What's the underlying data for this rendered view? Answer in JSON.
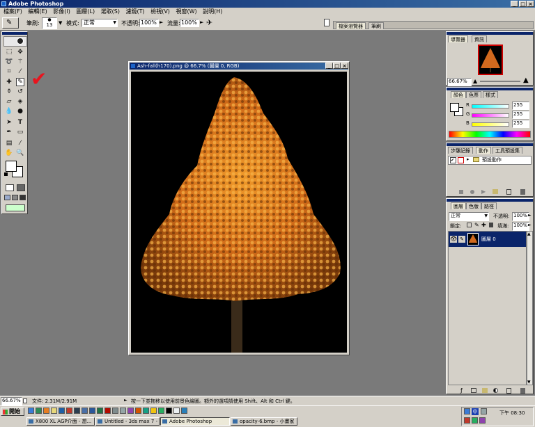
{
  "app": {
    "title": "Adobe Photoshop"
  },
  "menu": [
    "檔案(F)",
    "編輯(E)",
    "影像(I)",
    "圖層(L)",
    "選取(S)",
    "濾鏡(T)",
    "檢視(V)",
    "視窗(W)",
    "說明(H)"
  ],
  "options": {
    "brush_label": "筆刷:",
    "brush_size": "13",
    "mode_label": "模式:",
    "mode_value": "正常",
    "opacity_label": "不透明:",
    "opacity_value": "100%",
    "flow_label": "流量:",
    "flow_value": "100%",
    "well_tabs": [
      "檔案瀏覽器",
      "筆刷"
    ]
  },
  "annotation": {
    "mark": "✔",
    "color": "#e8141e"
  },
  "document": {
    "title": "Ash-fall(h170).png @ 66.7% (圖層 0, RGB)",
    "background": "#000000",
    "foliage_color": "#d2691e"
  },
  "navigator": {
    "tabs": [
      "導覽器",
      "資訊"
    ],
    "zoom": "66.67%"
  },
  "color_panel": {
    "tabs": [
      "顏色",
      "色票",
      "樣式"
    ],
    "channels": [
      {
        "label": "R",
        "value": "255",
        "gradient": "#00ffff"
      },
      {
        "label": "G",
        "value": "255",
        "gradient": "#ff00ff"
      },
      {
        "label": "B",
        "value": "255",
        "gradient": "#ffff00"
      }
    ]
  },
  "history_panel": {
    "tabs": [
      "步驟記錄",
      "動作",
      "工具預設集"
    ],
    "item": "預設動作"
  },
  "layers_panel": {
    "tabs": [
      "圖層",
      "色版",
      "路徑"
    ],
    "mode": "正常",
    "opacity_label": "不透明:",
    "opacity_value": "100%",
    "lock_label": "鎖定:",
    "fill_label": "填滿:",
    "fill_value": "100%",
    "layer_name": "圖層 0"
  },
  "status": {
    "zoom": "66.67%",
    "doc_info": "文件: 2.31M/2.91M",
    "hint": "按一下並拖移以使用前景色繪圖。額外的選項請使用 Shift、Alt 和 Ctrl 鍵。"
  },
  "taskbar": {
    "start": "開始",
    "tasks": [
      "X800 XL AGP介面 - 想...",
      "Untitled - 3ds max 7 - Sta...",
      "Adobe Photoshop",
      "opacity-6.bmp - 小畫家"
    ],
    "clock": "下午 08:30",
    "ime": "中"
  }
}
